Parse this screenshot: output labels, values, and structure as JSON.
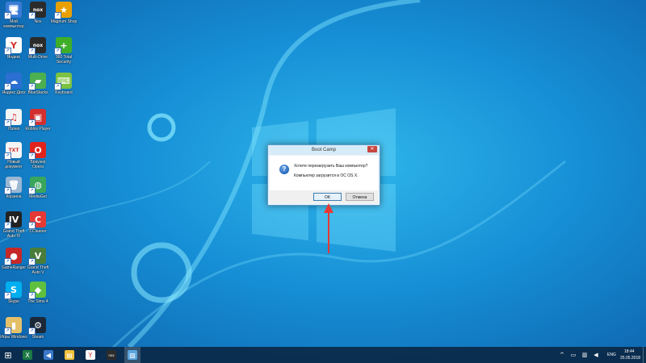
{
  "desktop": {
    "icons": [
      {
        "label": "Мой компьютер",
        "glyph": "🖥",
        "color": "#3a7bd5"
      },
      {
        "label": "Nox",
        "glyph": "nox",
        "color": "#2b2b2b"
      },
      {
        "label": "Magnum Shop",
        "glyph": "★",
        "color": "#e8a000"
      },
      {
        "label": "Яндекс",
        "glyph": "Y",
        "color": "#ffffff"
      },
      {
        "label": "Multi-Drive",
        "glyph": "nox",
        "color": "#2b2b2b"
      },
      {
        "label": "360 Total Security",
        "glyph": "+",
        "color": "#3fae29"
      },
      {
        "label": "Яндекс Диск",
        "glyph": "☁",
        "color": "#2a6fd1"
      },
      {
        "label": "BlueStacks",
        "glyph": "▰",
        "color": "#4caf50"
      },
      {
        "label": "Keyboard",
        "glyph": "⌨",
        "color": "#7cc242"
      },
      {
        "label": "iTunes",
        "glyph": "♫",
        "color": "#f5f5f5"
      },
      {
        "label": "Roblox Player",
        "glyph": "▣",
        "color": "#d32f2f"
      },
      {
        "label": "Новый документ",
        "glyph": "TXT",
        "color": "#f5f5f5"
      },
      {
        "label": "Браузер Opera",
        "glyph": "O",
        "color": "#e0241c"
      },
      {
        "label": "Корзина",
        "glyph": "🗑",
        "color": "#9bb7d4"
      },
      {
        "label": "MediaGet",
        "glyph": "◍",
        "color": "#3aa65b"
      },
      {
        "label": "Grand Theft Auto IV",
        "glyph": "IV",
        "color": "#222222"
      },
      {
        "label": "CCleaner",
        "glyph": "C",
        "color": "#e53935"
      },
      {
        "label": "GameRanger",
        "glyph": "●",
        "color": "#c62828"
      },
      {
        "label": "Grand Theft Auto V",
        "glyph": "V",
        "color": "#4a7d3a"
      },
      {
        "label": "Skype",
        "glyph": "S",
        "color": "#00aff0"
      },
      {
        "label": "The Sims 4",
        "glyph": "◆",
        "color": "#5fbf3f"
      },
      {
        "label": "Игры Windows",
        "glyph": "▮",
        "color": "#e5c06a"
      },
      {
        "label": "Steam",
        "glyph": "⚙",
        "color": "#1b2838"
      }
    ]
  },
  "dialog": {
    "title": "Boot Camp",
    "close_glyph": "✕",
    "question_glyph": "?",
    "message_line1": "Хотите перезагрузить Ваш компьютер?",
    "message_line2": "Компьютер загрузится в ОС OS X.",
    "ok_label": "OK",
    "cancel_label": "Отмена"
  },
  "annotation": {
    "arrow_color": "#e53935"
  },
  "taskbar": {
    "start_glyph": "⊞",
    "buttons": [
      {
        "name": "excel",
        "glyph": "X",
        "color": "#1d7a45"
      },
      {
        "name": "speaker",
        "glyph": "◀",
        "color": "#3a78c9"
      },
      {
        "name": "explorer",
        "glyph": "▤",
        "color": "#f0c13a"
      },
      {
        "name": "yandex",
        "glyph": "Y",
        "color": "#ffffff"
      },
      {
        "name": "nox",
        "glyph": "nox",
        "color": "#2b2b2b"
      },
      {
        "name": "bootcamp",
        "glyph": "▨",
        "color": "#5ba5e0"
      }
    ],
    "language": "ENG",
    "time": "18:44",
    "date": "25.05.2018"
  }
}
